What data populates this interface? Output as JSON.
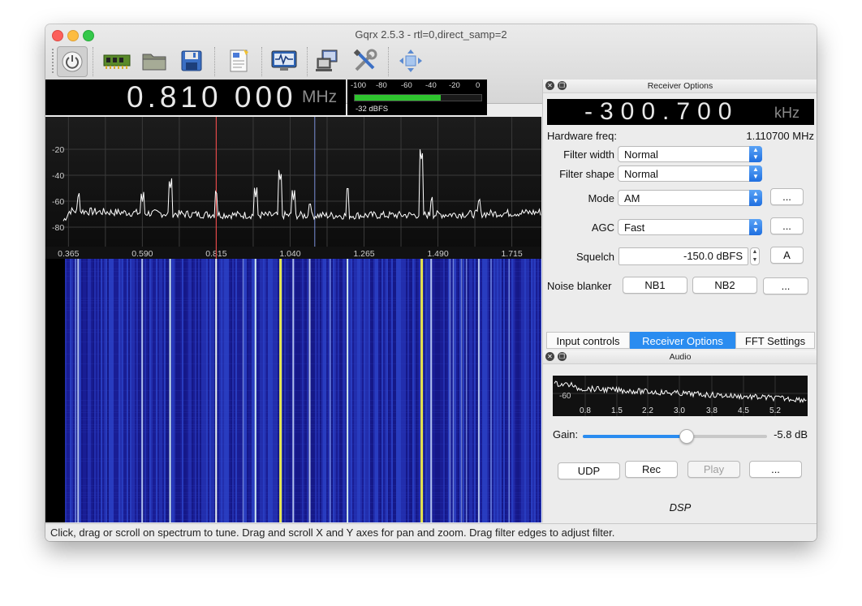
{
  "window": {
    "title": "Gqrx 2.5.3 - rtl=0,direct_samp=2"
  },
  "toolbar": {
    "items": [
      {
        "name": "power-icon"
      },
      {
        "name": "hardware-icon"
      },
      {
        "name": "open-folder-icon"
      },
      {
        "name": "save-icon"
      },
      {
        "name": "remote-control-icon"
      },
      {
        "name": "signal-monitor-icon"
      },
      {
        "name": "network-icon"
      },
      {
        "name": "settings-tools-icon"
      },
      {
        "name": "fullscreen-icon"
      }
    ]
  },
  "frequency": {
    "value": "0.810 000",
    "unit": "MHz"
  },
  "meter": {
    "scale": [
      "-100",
      "-80",
      "-60",
      "-40",
      "-20",
      "0"
    ],
    "level_fraction": 0.68,
    "reading": "-32 dBFS"
  },
  "chart_data": {
    "type": "line",
    "y_ticks": [
      "-20",
      "-40",
      "-60",
      "-80"
    ],
    "x_ticks": [
      "0.365",
      "0.590",
      "0.815",
      "1.040",
      "1.265",
      "1.490",
      "1.715"
    ],
    "peaks": [
      {
        "freq": 0.395,
        "db": -59
      },
      {
        "freq": 0.59,
        "db": -61
      },
      {
        "freq": 0.675,
        "db": -51
      },
      {
        "freq": 0.815,
        "db": -57
      },
      {
        "freq": 0.935,
        "db": -57
      },
      {
        "freq": 1.01,
        "db": -45
      },
      {
        "freq": 1.05,
        "db": -59
      },
      {
        "freq": 1.1,
        "db": -66
      },
      {
        "freq": 1.215,
        "db": -54
      },
      {
        "freq": 1.44,
        "db": -29
      },
      {
        "freq": 1.47,
        "db": -62
      },
      {
        "freq": 1.615,
        "db": -63
      }
    ],
    "noise_floor_db": -69,
    "tuned_freq": 0.815,
    "filter_freq": 1.115
  },
  "receiver": {
    "dock_title": "Receiver Options",
    "offset": {
      "value": "-300.700",
      "unit": "kHz"
    },
    "hw_freq_label": "Hardware freq:",
    "hw_freq_value": "1.110700 MHz",
    "filter_width_label": "Filter width",
    "filter_width_value": "Normal",
    "filter_shape_label": "Filter shape",
    "filter_shape_value": "Normal",
    "mode_label": "Mode",
    "mode_value": "AM",
    "agc_label": "AGC",
    "agc_value": "Fast",
    "more_label": "...",
    "squelch_label": "Squelch",
    "squelch_value": "-150.0 dBFS",
    "squelch_auto_label": "A",
    "noise_blanker_label": "Noise blanker",
    "nb1_label": "NB1",
    "nb2_label": "NB2"
  },
  "tabs": [
    {
      "label": "Input controls",
      "active": false
    },
    {
      "label": "Receiver Options",
      "active": true
    },
    {
      "label": "FFT Settings",
      "active": false
    }
  ],
  "audio": {
    "dock_title": "Audio",
    "level_label": "-60",
    "freq_ticks": [
      "0.8",
      "1.5",
      "2.2",
      "3.0",
      "3.8",
      "4.5",
      "5.2"
    ],
    "gain_label": "Gain:",
    "gain_value": "-5.8 dB",
    "gain_fraction": 0.56,
    "udp_label": "UDP",
    "rec_label": "Rec",
    "play_label": "Play",
    "more_label": "...",
    "dsp_label": "DSP"
  },
  "status": {
    "text": "Click, drag or scroll on spectrum to tune. Drag and scroll X and Y axes for pan and zoom. Drag filter edges to adjust filter."
  }
}
